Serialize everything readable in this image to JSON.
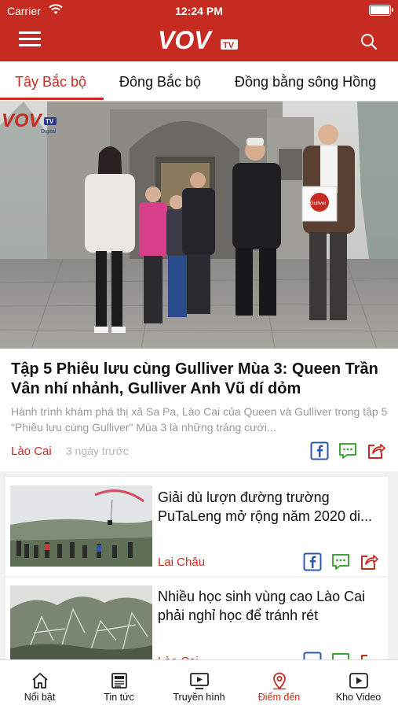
{
  "status": {
    "carrier": "Carrier",
    "time": "12:24 PM"
  },
  "header": {
    "logo": "VOV",
    "logo_badge": "TV"
  },
  "tabs": [
    {
      "label": "Tây Bắc bộ",
      "active": true
    },
    {
      "label": "Đông Bắc bộ",
      "active": false
    },
    {
      "label": "Đồng bằng sông Hồng",
      "active": false
    }
  ],
  "hero": {
    "watermark": "VOV",
    "watermark_badge": "TV",
    "watermark_sub": "Digital",
    "sign_text": "Gulliver",
    "title": "Tập 5 Phiêu lưu cùng Gulliver Mùa 3: Queen Trần Vân nhí nhảnh, Gulliver Anh Vũ dí dỏm",
    "description": "Hành trình khám phá thị xã Sa Pa, Lào Cai của Queen và Gulliver trong tập 5 \"Phiêu lưu cùng Gulliver\" Mùa 3 là những trảng cười...",
    "category": "Lào Cai",
    "time": "3 ngày trước"
  },
  "articles": [
    {
      "title": "Giải dù lượn đường trường PuTaLeng mở rộng năm 2020 di...",
      "category": "Lai Châu"
    },
    {
      "title": "Nhiều học sinh vùng cao Lào Cai phải nghỉ học để tránh rét",
      "category": "Lào Cai"
    }
  ],
  "icons": {
    "share_fb": "facebook-icon",
    "comment": "comment-icon",
    "share": "share-icon"
  },
  "colors": {
    "brand": "#c52b20",
    "facebook": "#2d5aa8",
    "comment": "#3fa535"
  },
  "bottom_nav": [
    {
      "label": "Nổi bật",
      "icon": "home-icon",
      "active": false
    },
    {
      "label": "Tin tức",
      "icon": "newspaper-icon",
      "active": false
    },
    {
      "label": "Truyền hình",
      "icon": "tv-icon",
      "active": false
    },
    {
      "label": "Điểm đến",
      "icon": "location-pin-icon",
      "active": true
    },
    {
      "label": "Kho Video",
      "icon": "video-icon",
      "active": false
    }
  ]
}
